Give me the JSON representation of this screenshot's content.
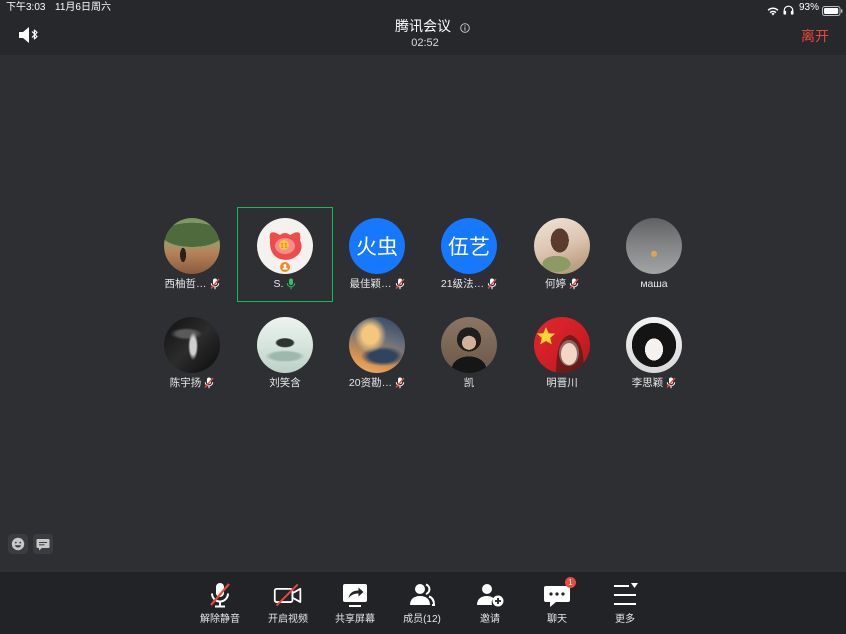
{
  "status_bar": {
    "time": "下午3:03",
    "date": "11月6日周六",
    "battery": "93%"
  },
  "header": {
    "title": "腾讯会议",
    "timer": "02:52",
    "leave_label": "离开"
  },
  "participants": [
    {
      "name": "西柚哲…",
      "mic_icon": "mic-muted-icon"
    },
    {
      "name": "S.",
      "mic_icon": "mic-active-icon",
      "speaking": true
    },
    {
      "name": "最佳颖…",
      "avatar_text": "火虫",
      "mic_icon": "mic-muted-icon"
    },
    {
      "name": "21级法…",
      "avatar_text": "伍艺",
      "mic_icon": "mic-muted-icon"
    },
    {
      "name": "何婷",
      "mic_icon": "mic-muted-icon"
    },
    {
      "name": "маша"
    },
    {
      "name": "陈宇扬",
      "mic_icon": "mic-muted-icon"
    },
    {
      "name": "刘笑含"
    },
    {
      "name": "20资勘…",
      "mic_icon": "mic-muted-icon"
    },
    {
      "name": "凯"
    },
    {
      "name": "明晋川"
    },
    {
      "name": "李思颖",
      "mic_icon": "mic-muted-icon"
    }
  ],
  "toolbar": {
    "unmute": "解除静音",
    "start_video": "开启视频",
    "share_screen": "共享屏幕",
    "members": "成员(12)",
    "invite": "邀请",
    "chat": "聊天",
    "chat_badge": "1",
    "more": "更多"
  },
  "colors": {
    "leave": "#e8473f",
    "active_speaker_border": "#1fb35a",
    "text_avatar": "#1677ff",
    "muted_slash": "#e8473f",
    "mic_active": "#2fc26a",
    "badge": "#f04a3e"
  }
}
